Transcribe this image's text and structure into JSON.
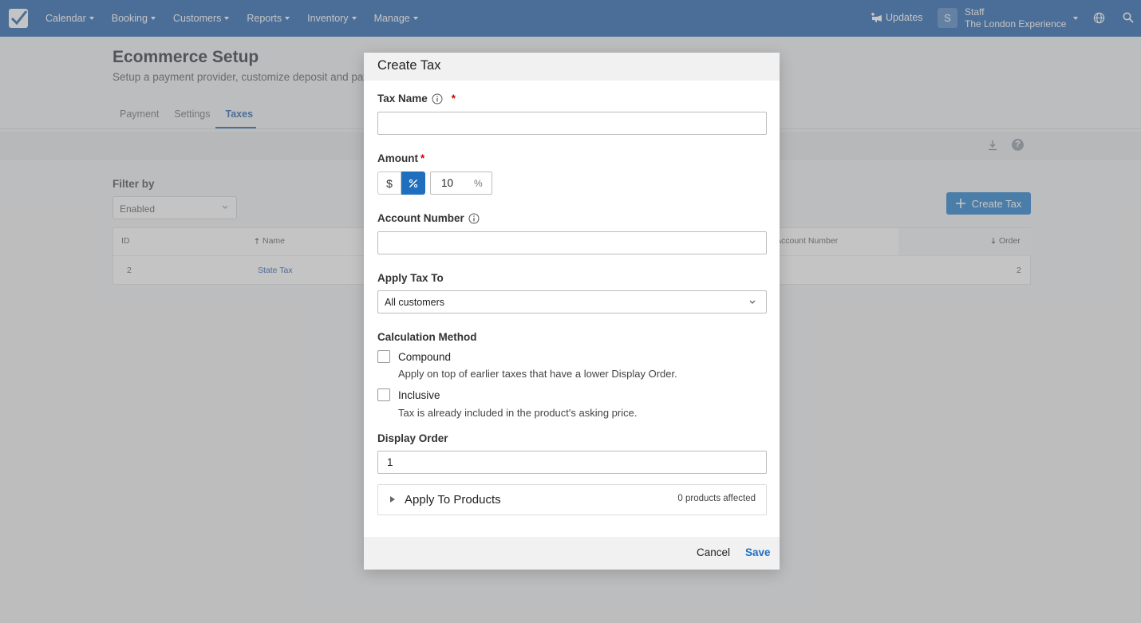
{
  "nav": {
    "items": [
      "Calendar",
      "Booking",
      "Customers",
      "Reports",
      "Inventory",
      "Manage"
    ],
    "updates": "Updates",
    "avatar_initial": "S",
    "user_role": "Staff",
    "company": "The London Experience"
  },
  "page": {
    "title": "Ecommerce Setup",
    "subtitle": "Setup a payment provider, customize deposit and pay",
    "tabs": [
      "Payment",
      "Settings",
      "Taxes"
    ],
    "active_tab": "Taxes",
    "help_glyph": "?"
  },
  "filter": {
    "label": "Filter by",
    "value": "Enabled"
  },
  "create_tax_button": "Create Tax",
  "table": {
    "headers": {
      "id": "ID",
      "name": "Name",
      "account_number": "Account Number",
      "order": "Order"
    },
    "rows": [
      {
        "id": "2",
        "name": "State Tax",
        "order": "2"
      }
    ]
  },
  "modal": {
    "title": "Create Tax",
    "tax_name_label": "Tax Name",
    "tax_name_value": "",
    "required_mark": "*",
    "amount_label": "Amount",
    "amount_type_dollar": "$",
    "amount_type_percent": "%",
    "amount_value": "10",
    "amount_unit": "%",
    "account_number_label": "Account Number",
    "account_number_value": "",
    "apply_tax_to_label": "Apply Tax To",
    "apply_tax_to_value": "All customers",
    "calculation_method_label": "Calculation Method",
    "compound_label": "Compound",
    "compound_desc": "Apply on top of earlier taxes that have a lower Display Order.",
    "compound_checked": false,
    "inclusive_label": "Inclusive",
    "inclusive_desc": "Tax is already included in the product's asking price.",
    "inclusive_checked": false,
    "display_order_label": "Display Order",
    "display_order_value": "1",
    "apply_to_products_label": "Apply To Products",
    "products_affected": "0 products affected",
    "cancel_label": "Cancel",
    "save_label": "Save"
  },
  "colors": {
    "nav_bg": "#2f6cb3",
    "accent": "#1f6fbf",
    "required": "#cc0000"
  }
}
